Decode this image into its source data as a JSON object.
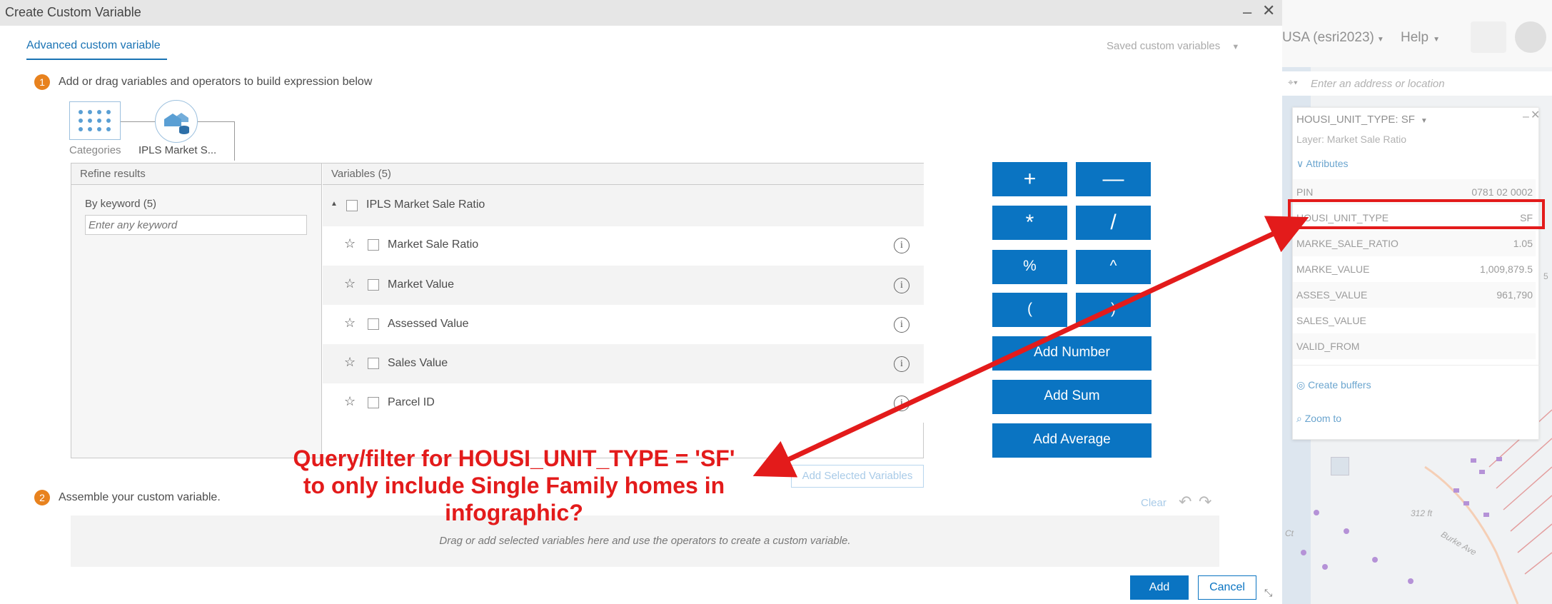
{
  "dialog": {
    "title": "Create Custom Variable",
    "tab_advanced": "Advanced custom variable",
    "saved_variables": "Saved custom variables",
    "step1_num": "1",
    "step1_text": "Add or drag variables and operators to build expression below",
    "step2_num": "2",
    "step2_text": "Assemble your custom variable.",
    "breadcrumb": [
      {
        "label": "Categories",
        "icon": "grid-icon"
      },
      {
        "label": "IPLS Market S...",
        "icon": "house-database-icon"
      }
    ],
    "refine": {
      "header": "Refine results",
      "keyword_label": "By keyword (5)",
      "keyword_placeholder": "Enter any keyword"
    },
    "variables": {
      "header": "Variables (5)",
      "group": "IPLS Market Sale Ratio",
      "items": [
        "Market Sale Ratio",
        "Market Value",
        "Assessed Value",
        "Sales Value",
        "Parcel ID"
      ]
    },
    "operators": {
      "plus": "+",
      "minus": "—",
      "times": "*",
      "divide": "/",
      "percent": "%",
      "power": "^",
      "lparen": "(",
      "rparen": ")",
      "add_number": "Add Number",
      "add_sum": "Add Sum",
      "add_average": "Add Average"
    },
    "add_selected": "Add Selected Variables",
    "clear": "Clear",
    "dropzone_text": "Drag or add selected variables here and use the operators to create a custom variable.",
    "add": "Add",
    "cancel": "Cancel"
  },
  "map": {
    "account": "USA (esri2023)",
    "help": "Help",
    "search_placeholder": "Enter an address or location",
    "popup": {
      "title": "HOUSI_UNIT_TYPE: SF",
      "layer": "Layer: Market Sale Ratio",
      "attributes_label": "Attributes",
      "fields": [
        {
          "name": "PIN",
          "value": "0781 02 0002"
        },
        {
          "name": "HOUSI_UNIT_TYPE",
          "value": "SF"
        },
        {
          "name": "MARKE_SALE_RATIO",
          "value": "1.05"
        },
        {
          "name": "MARKE_VALUE",
          "value": "1,009,879.5"
        },
        {
          "name": "ASSES_VALUE",
          "value": "961,790"
        },
        {
          "name": "SALES_VALUE",
          "value": ""
        },
        {
          "name": "VALID_FROM",
          "value": ""
        }
      ],
      "create_buffers": "Create buffers",
      "zoom_to": "Zoom to"
    },
    "street_labels": [
      "312 ft",
      "Ct",
      "Burke Ave",
      "5"
    ]
  },
  "annotation": {
    "text_line1": "Query/filter for HOUSI_UNIT_TYPE = 'SF'",
    "text_line2": "to only include Single Family homes in",
    "text_line3": "infographic?",
    "color": "#e31b1b"
  },
  "colors": {
    "accent": "#0a74c2",
    "step_badge": "#e8821e"
  }
}
